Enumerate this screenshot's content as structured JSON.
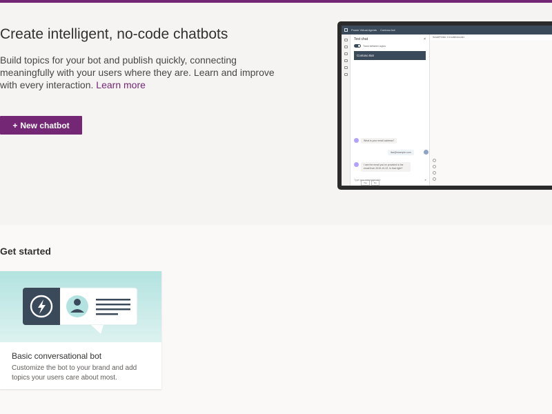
{
  "hero": {
    "title": "Create intelligent, no-code chatbots",
    "description": "Build topics for your bot and publish quickly, connecting meaningfully with your users where they are. Learn and improve with every interaction.",
    "learn_more": "Learn more",
    "new_button_icon": "+",
    "new_button_label": "New chatbot"
  },
  "mockup": {
    "app_name": "Power Virtual Agents",
    "bot_name_short": "Contoso bot",
    "test_chat_title": "Test chat",
    "close_glyph": "×",
    "toggle_label": "Track between topics",
    "bot_header": "Contoso Bot",
    "messages": [
      "What is your email address?",
      "lisa@example.com",
      "I see the email you've provided is the email from 2019-10-22. Is that right?"
    ],
    "chips": [
      "Yes",
      "No"
    ],
    "input_placeholder": "Type your message here",
    "send_glyph": "➤",
    "canvas_title": "SmartPrinter 4 troubleshooter"
  },
  "get_started": {
    "heading": "Get started"
  },
  "card": {
    "title": "Basic conversational bot",
    "description": "Customize the bot to your brand and add topics your users care about most."
  },
  "colors": {
    "accent": "#742774",
    "dark_slate": "#3b4a5a",
    "teal_bg": "#b3e3e0"
  }
}
